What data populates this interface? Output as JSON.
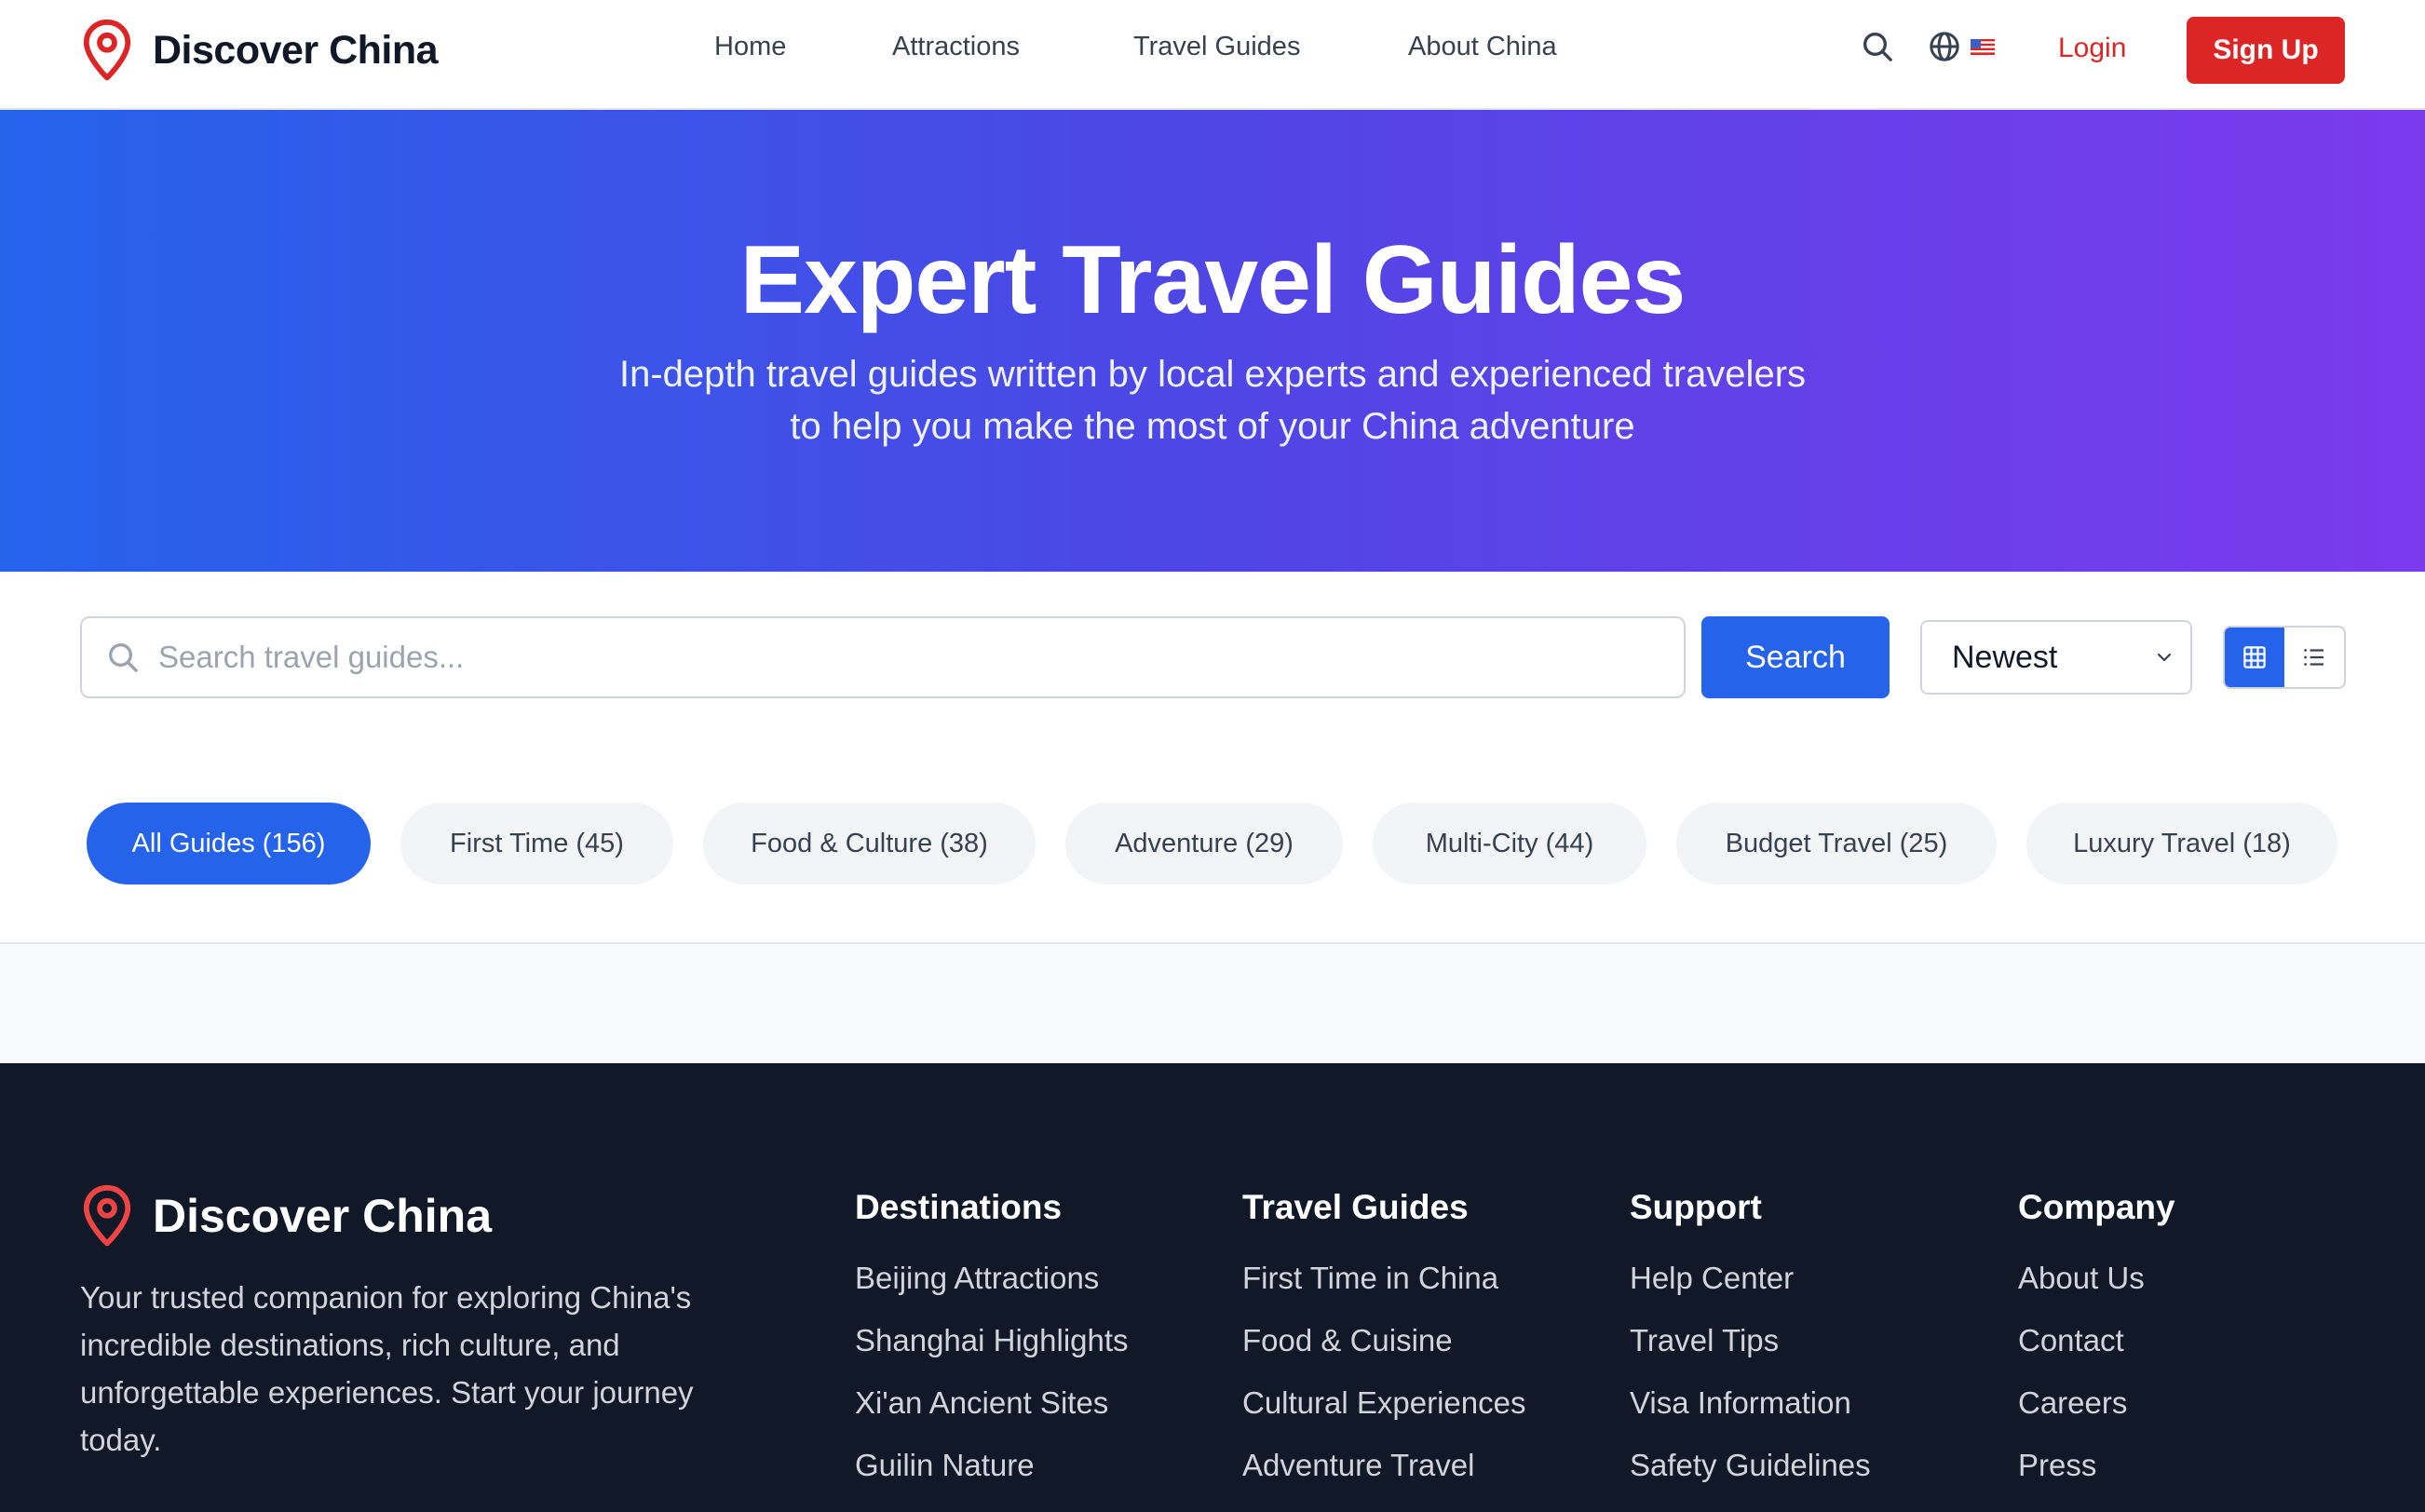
{
  "brand": {
    "name": "Discover China"
  },
  "nav": {
    "links": [
      "Home",
      "Attractions",
      "Travel Guides",
      "About China"
    ],
    "login": "Login",
    "signup": "Sign Up",
    "icons": {
      "search": "search-icon",
      "language": "globe-icon",
      "flag": "us-flag-icon"
    }
  },
  "hero": {
    "title": "Expert Travel Guides",
    "subtitle": "In-depth travel guides written by local experts and experienced travelers to help you make the most of your China adventure"
  },
  "search": {
    "placeholder": "Search travel guides...",
    "value": "",
    "button": "Search",
    "sort_selected": "Newest",
    "view_modes": [
      "grid",
      "list"
    ],
    "view_active": "grid"
  },
  "filters": [
    {
      "label": "All Guides (156)",
      "active": true
    },
    {
      "label": "First Time (45)",
      "active": false
    },
    {
      "label": "Food & Culture (38)",
      "active": false
    },
    {
      "label": "Adventure (29)",
      "active": false
    },
    {
      "label": "Multi-City (44)",
      "active": false
    },
    {
      "label": "Budget Travel (25)",
      "active": false
    },
    {
      "label": "Luxury Travel (18)",
      "active": false
    }
  ],
  "footer": {
    "brand": "Discover China",
    "description": "Your trusted companion for exploring China's incredible destinations, rich culture, and unforgettable experiences. Start your journey today.",
    "columns": [
      {
        "title": "Destinations",
        "links": [
          "Beijing Attractions",
          "Shanghai Highlights",
          "Xi'an Ancient Sites",
          "Guilin Nature"
        ]
      },
      {
        "title": "Travel Guides",
        "links": [
          "First Time in China",
          "Food & Cuisine",
          "Cultural Experiences",
          "Adventure Travel"
        ]
      },
      {
        "title": "Support",
        "links": [
          "Help Center",
          "Travel Tips",
          "Visa Information",
          "Safety Guidelines"
        ]
      },
      {
        "title": "Company",
        "links": [
          "About Us",
          "Contact",
          "Careers",
          "Press"
        ]
      }
    ]
  },
  "colors": {
    "primary": "#2563eb",
    "accent_red": "#dc2626",
    "hero_gradient_start": "#2563eb",
    "hero_gradient_end": "#7c3aed",
    "footer_bg": "#111827"
  }
}
